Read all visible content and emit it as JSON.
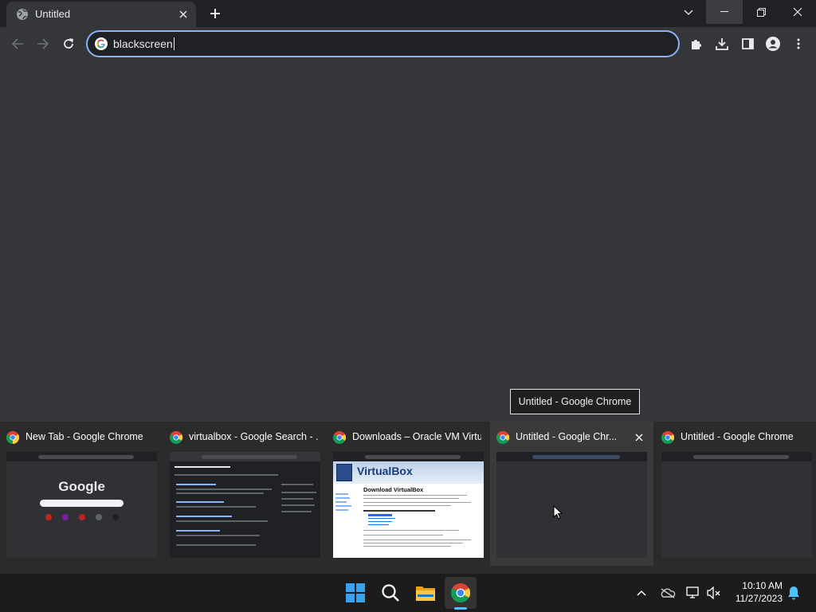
{
  "colors": {
    "titlebar": "#202124",
    "toolbar": "#35363a",
    "omnibox_border": "#8ab4f8",
    "taskbar": "#1c1c1c",
    "accent": "#4cc2ff"
  },
  "browser": {
    "tab": {
      "title": "Untitled",
      "icon": "globe-icon"
    },
    "omnibox": {
      "value": "blackscreen",
      "icon": "google-g-icon"
    }
  },
  "tooltip": {
    "text": "Untitled - Google Chrome"
  },
  "thumbnails": [
    {
      "title": "New Tab - Google Chrome",
      "preview": "google-new-tab",
      "preview_text": "Google"
    },
    {
      "title": "virtualbox - Google Search - ...",
      "preview": "search-results"
    },
    {
      "title": "Downloads – Oracle VM Virtu...",
      "preview": "virtualbox-site",
      "preview_heading": "VirtualBox",
      "preview_subheading": "Download VirtualBox"
    },
    {
      "title": "Untitled - Google Chr...",
      "preview": "blank",
      "hovered": true
    },
    {
      "title": "Untitled - Google Chrome",
      "preview": "blank"
    }
  ],
  "taskbar": {
    "apps": [
      "start-icon",
      "search-icon",
      "file-explorer-icon",
      "chrome-icon"
    ],
    "tray": [
      "chevron-up-icon",
      "onedrive-icon",
      "network-icon",
      "volume-muted-icon"
    ],
    "clock": {
      "time": "10:10 AM",
      "date": "11/27/2023"
    },
    "notification_icon": "bell-icon"
  }
}
